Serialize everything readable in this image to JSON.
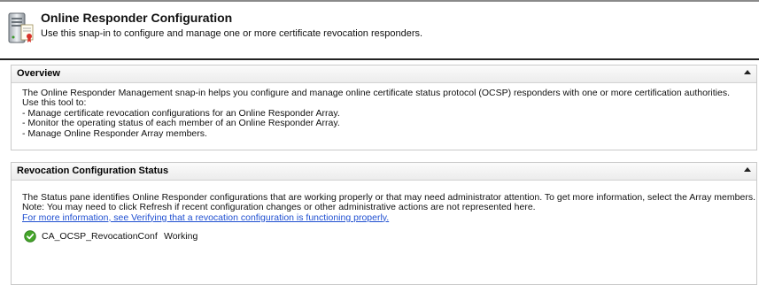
{
  "header": {
    "title": "Online Responder Configuration",
    "subtitle": "Use this snap-in to configure and manage one or more certificate revocation responders.",
    "icon": "server-certificate-icon"
  },
  "overview": {
    "title": "Overview",
    "lines": [
      "The Online Responder Management snap-in helps you configure and manage online certificate status protocol (OCSP) responders with one or more certification authorities.",
      "Use this tool to:",
      "- Manage certificate revocation configurations for an Online Responder Array.",
      "- Monitor the operating status of each member of an Online Responder Array.",
      "- Manage Online Responder Array members."
    ]
  },
  "revocation": {
    "title": "Revocation Configuration Status",
    "lines": [
      "The Status pane identifies Online Responder configurations that are working properly or that may need administrator attention. To get more information, select the Array members.",
      "Note: You may need to click Refresh if recent configuration changes or other administrative actions are not represented here."
    ],
    "link": "For more information, see Verifying that a revocation configuration is functioning properly.",
    "configurations": [
      {
        "name": "CA_OCSP_RevocationConf",
        "status": "Working",
        "status_color": "#3a9a1f"
      }
    ]
  }
}
